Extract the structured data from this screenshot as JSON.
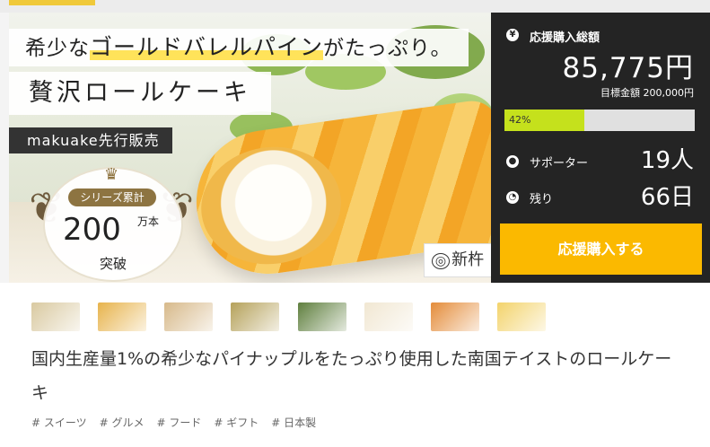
{
  "hero": {
    "headline_a": "希少な",
    "headline_b": "ゴールドバレルパイン",
    "headline_c": "がたっぷり。",
    "subline": "贅沢ロールケーキ",
    "sale_label": "makuake先行販売",
    "badge_series": "シリーズ累計",
    "badge_number": "200",
    "badge_unit": "万本",
    "badge_breakthrough": "突破",
    "brand_name": "新杵堂"
  },
  "panel": {
    "total_label": "応援購入総額",
    "total_value": "85,775円",
    "goal_text": "目標金額 200,000円",
    "progress_percent": 42,
    "progress_text": "42%",
    "supporters_label": "サポーター",
    "supporters_value": "19人",
    "remaining_label": "残り",
    "remaining_value": "66日",
    "buy_button": "応援購入する",
    "icons": [
      "yen-icon",
      "person-icon",
      "clock-icon"
    ]
  },
  "thumbnails": [
    {
      "name": "thumbnail-1",
      "color": "#d9c9a0"
    },
    {
      "name": "thumbnail-2",
      "color": "#e7b34c"
    },
    {
      "name": "thumbnail-3",
      "color": "#d7b98a"
    },
    {
      "name": "thumbnail-4",
      "color": "#b5a15a"
    },
    {
      "name": "thumbnail-5",
      "color": "#5f7f3e"
    },
    {
      "name": "thumbnail-6",
      "color": "#f1e7d2"
    },
    {
      "name": "thumbnail-7",
      "color": "#e48c3a"
    },
    {
      "name": "thumbnail-8",
      "color": "#f3d36b"
    }
  ],
  "description": "国内生産量1%の希少なパイナップルをたっぷり使用した南国テイストのロールケーキ",
  "tags": [
    "# スイーツ",
    "# グルメ",
    "# フード",
    "# ギフト",
    "# 日本製"
  ],
  "colors": {
    "accent": "#fbb900",
    "progress": "#c5e11c",
    "panel": "#242424"
  }
}
